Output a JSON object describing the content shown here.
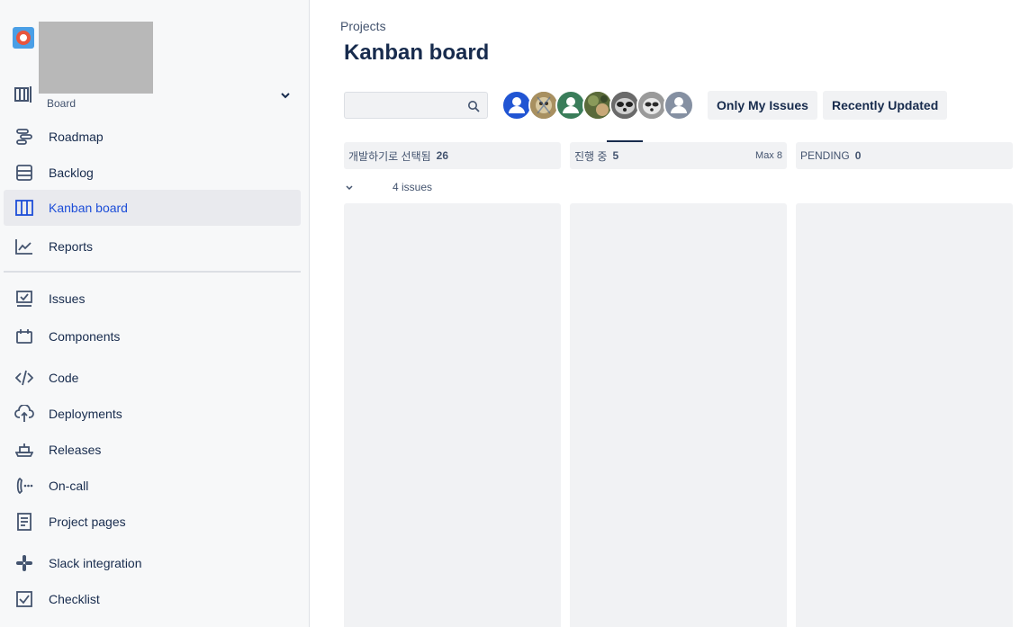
{
  "sidebar": {
    "board_sub": "Board",
    "items": [
      {
        "label": "Roadmap",
        "icon": "roadmap-icon"
      },
      {
        "label": "Backlog",
        "icon": "backlog-icon"
      },
      {
        "label": "Kanban board",
        "icon": "kanban-icon",
        "active": true
      },
      {
        "label": "Reports",
        "icon": "reports-icon"
      },
      {
        "label": "Issues",
        "icon": "issues-icon"
      },
      {
        "label": "Components",
        "icon": "components-icon"
      },
      {
        "label": "Code",
        "icon": "code-icon"
      },
      {
        "label": "Deployments",
        "icon": "deployments-icon"
      },
      {
        "label": "Releases",
        "icon": "releases-icon"
      },
      {
        "label": "On-call",
        "icon": "on-call-icon"
      },
      {
        "label": "Project pages",
        "icon": "project-pages-icon"
      },
      {
        "label": "Slack integration",
        "icon": "slack-icon"
      },
      {
        "label": "Checklist",
        "icon": "checklist-icon"
      }
    ]
  },
  "header": {
    "breadcrumb": "Projects",
    "title": "Kanban board"
  },
  "toolbar": {
    "search_placeholder": "",
    "only_my_issues": "Only My Issues",
    "recently_updated": "Recently Updated"
  },
  "columns": [
    {
      "name": "개발하기로 선택됨",
      "count": "26",
      "max": ""
    },
    {
      "name": "진행 중",
      "count": "5",
      "max": "Max 8"
    },
    {
      "name": "PENDING",
      "count": "0",
      "max": ""
    }
  ],
  "swimlane": {
    "label": "4 issues"
  },
  "colors": {
    "accent": "#1d4ed8",
    "avatar_blue": "#2155d3",
    "avatar_green": "#3a7d5a",
    "avatar_gray": "#8590a2"
  }
}
